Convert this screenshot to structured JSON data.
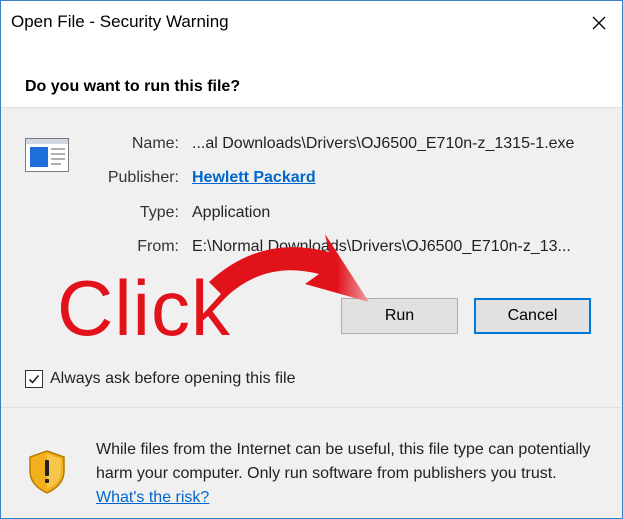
{
  "window": {
    "title": "Open File - Security Warning"
  },
  "header": {
    "question": "Do you want to run this file?"
  },
  "file": {
    "name_label": "Name:",
    "name_value": "...al Downloads\\Drivers\\OJ6500_E710n-z_1315-1.exe",
    "publisher_label": "Publisher:",
    "publisher_value": "Hewlett Packard",
    "type_label": "Type:",
    "type_value": "Application",
    "from_label": "From:",
    "from_value": "E:\\Normal Downloads\\Drivers\\OJ6500_E710n-z_13..."
  },
  "buttons": {
    "run": "Run",
    "cancel": "Cancel"
  },
  "annotation": {
    "text": "Click",
    "color": "#e1121a"
  },
  "checkbox": {
    "label": "Always ask before opening this file",
    "checked": true
  },
  "warning": {
    "text": "While files from the Internet can be useful, this file type can potentially harm your computer. Only run software from publishers you trust. ",
    "link": "What's the risk?"
  },
  "icons": {
    "close": "close-icon",
    "file": "application-file-icon",
    "shield": "warning-shield-icon",
    "check": "checkmark-icon",
    "arrow": "red-arrow-annotation"
  },
  "colors": {
    "accent": "#0078d7",
    "link": "#0066cc",
    "dialog_bg": "#f0f0f0"
  }
}
